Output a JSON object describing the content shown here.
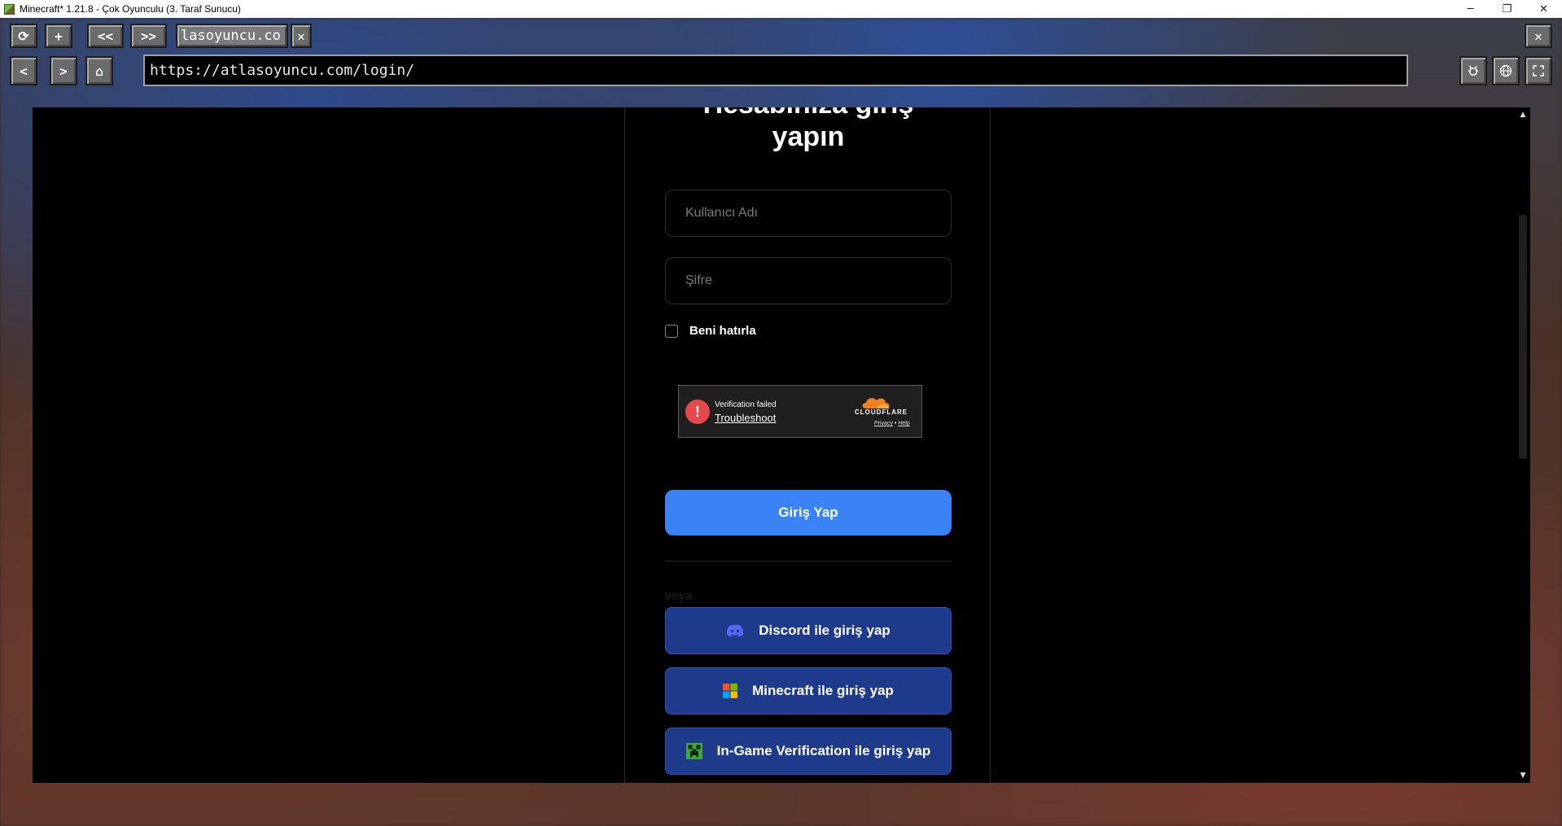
{
  "window": {
    "title": "Minecraft* 1.21.8 - Çok Oyunculu (3. Taraf Sunucu)",
    "minimize": "─",
    "maximize": "❐",
    "close": "✕"
  },
  "toolbar": {
    "reload": "⟳",
    "new_tab": "+",
    "prev_tab": "<<",
    "next_tab": ">>",
    "tab_title": "lasoyuncu.co",
    "tab_close": "✕",
    "close_browser": "✕",
    "back": "<",
    "forward": ">",
    "home": "⌂",
    "url": "https://atlasoyuncu.com/login/",
    "right_icons": [
      "bug-icon",
      "globe-icon",
      "fullscreen-icon"
    ]
  },
  "page": {
    "heading_line1": "Hesabınıza giriş",
    "heading_line2": "yapın",
    "username_placeholder": "Kullanıcı Adı",
    "password_placeholder": "Şifre",
    "remember_label": "Beni hatırla",
    "captcha": {
      "status": "Verification failed",
      "link": "Troubleshoot",
      "brand": "CLOUDFLARE",
      "privacy": "Privacy",
      "sep": "•",
      "help": "Help"
    },
    "login_button": "Giriş Yap",
    "or_text": "veya",
    "social": [
      {
        "label": "Discord ile giriş yap",
        "icon": "discord-icon"
      },
      {
        "label": "Minecraft ile giriş yap",
        "icon": "microsoft-icon"
      },
      {
        "label": "In-Game Verification ile giriş yap",
        "icon": "creeper-icon"
      }
    ]
  },
  "colors": {
    "primary": "#3b82f6",
    "social_bg": "#1e3a8a",
    "error": "#e5484d"
  }
}
